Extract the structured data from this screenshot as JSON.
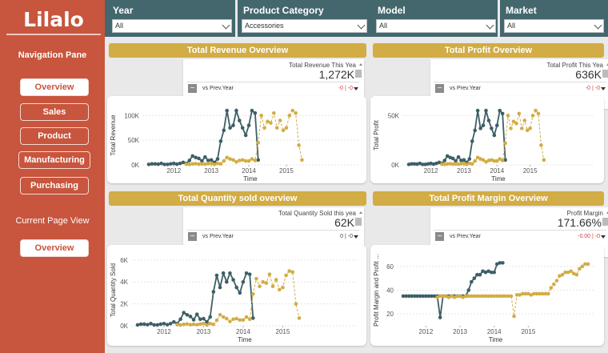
{
  "sidebar": {
    "logo": "Lilalo",
    "nav_title": "Navigation Pane",
    "nav_items": [
      "Overview",
      "Sales",
      "Product",
      "Manufacturing",
      "Purchasing"
    ],
    "current_title": "Current Page View",
    "current_page": "Overview"
  },
  "filters": [
    {
      "label": "Year",
      "value": "All"
    },
    {
      "label": "Product Category",
      "value": "Accessories"
    },
    {
      "label": "Model",
      "value": "All"
    },
    {
      "label": "Market",
      "value": "All"
    }
  ],
  "sections": {
    "revenue": "Total Revenue Overview",
    "profit": "Total Profit Overview",
    "quantity": "Total Quantity sold overview",
    "margin": "Total Profit Margin Overview"
  },
  "kpis": {
    "revenue": {
      "label": "Total Revenue This Yea",
      "value": "1,272K",
      "vs": "vs Prev.Year",
      "delta": "-0 | -0"
    },
    "profit": {
      "label": "Total Profit This Yea",
      "value": "636K",
      "vs": "vs Prev.Year",
      "delta": "-0 | -0"
    },
    "quantity": {
      "label": "Total Quantity Sold this yea",
      "value": "62K",
      "vs": "vs Prev.Year",
      "delta": "0 | -0"
    },
    "margin": {
      "label": "Profit Margin",
      "value": "171.66%",
      "vs": "vs Prev.Year",
      "delta": "-0.00 | -0"
    }
  },
  "colors": {
    "current_series": "#3d5f66",
    "previous_series": "#d2ac44",
    "sidebar": "#c8553d",
    "filterbar": "#44676e"
  },
  "chart_data": [
    {
      "type": "line",
      "id": "revenue",
      "ylabel": "Total Revenue",
      "xlabel": "Time",
      "x_ticks": [
        "2012",
        "2013",
        "2014",
        "2015"
      ],
      "y_ticks": [
        "0K",
        "50K",
        "100K"
      ],
      "ylim": [
        0,
        120000
      ],
      "series": [
        {
          "values": [
            1000,
            2000,
            2000,
            1500,
            3000,
            1000,
            1000,
            2000,
            3000,
            1500,
            3000,
            5000,
            3000,
            9000,
            18000,
            15000,
            13000,
            8000,
            16000,
            9000,
            10000,
            5000,
            12000,
            48000,
            70000,
            110000,
            75000,
            80000,
            110000,
            90000,
            75000,
            60000,
            80000,
            110000,
            105000,
            10000
          ]
        },
        {
          "values": [
            null,
            null,
            null,
            null,
            null,
            null,
            null,
            null,
            null,
            null,
            null,
            null,
            1500,
            1000,
            2000,
            2500,
            1500,
            2000,
            1500,
            2500,
            3000,
            1000,
            3000,
            2000,
            8000,
            15000,
            12000,
            10000,
            6000,
            9000,
            10000,
            8000,
            8000,
            12000,
            9000,
            45000,
            100000,
            75000,
            88000,
            85000,
            105000,
            75000,
            90000,
            70000,
            75000,
            100000,
            110000,
            105000,
            40000,
            10000
          ]
        }
      ]
    },
    {
      "type": "line",
      "id": "profit",
      "ylabel": "Total Profit",
      "xlabel": "Time",
      "x_ticks": [
        "2012",
        "2013",
        "2014",
        "2015"
      ],
      "y_ticks": [
        "0K",
        "50K"
      ],
      "ylim": [
        0,
        60000
      ],
      "series": [
        {
          "values": [
            500,
            1000,
            1000,
            800,
            1500,
            500,
            500,
            1000,
            1500,
            800,
            1500,
            2500,
            1500,
            4500,
            9000,
            7500,
            6500,
            4000,
            8000,
            4500,
            5000,
            2500,
            6000,
            24000,
            35000,
            55000,
            37000,
            40000,
            55000,
            45000,
            37000,
            30000,
            40000,
            55000,
            52000,
            5000
          ]
        },
        {
          "values": [
            null,
            null,
            null,
            null,
            null,
            null,
            null,
            null,
            null,
            null,
            null,
            null,
            700,
            500,
            1000,
            1200,
            700,
            1000,
            700,
            1200,
            1500,
            500,
            1500,
            1000,
            4000,
            7500,
            6000,
            5000,
            3000,
            4500,
            5000,
            4000,
            4000,
            6000,
            4500,
            22000,
            50000,
            37000,
            44000,
            42000,
            52000,
            37000,
            45000,
            35000,
            37000,
            50000,
            55000,
            52000,
            20000,
            5000
          ]
        }
      ]
    },
    {
      "type": "line",
      "id": "quantity",
      "ylabel": "Total Quantity Sold",
      "xlabel": "Time",
      "x_ticks": [
        "2012",
        "2013",
        "2014",
        "2015"
      ],
      "y_ticks": [
        "0K",
        "2K",
        "4K",
        "6K"
      ],
      "ylim": [
        0,
        6500
      ],
      "series": [
        {
          "values": [
            80,
            150,
            150,
            100,
            200,
            80,
            80,
            150,
            200,
            100,
            200,
            350,
            200,
            600,
            1200,
            1000,
            850,
            550,
            1050,
            600,
            650,
            350,
            800,
            3100,
            4600,
            3500,
            4800,
            4000,
            4800,
            4200,
            3500,
            3000,
            4000,
            4800,
            4700,
            700
          ]
        },
        {
          "values": [
            null,
            null,
            null,
            null,
            null,
            null,
            null,
            null,
            null,
            null,
            null,
            null,
            100,
            70,
            130,
            160,
            100,
            130,
            100,
            160,
            200,
            70,
            200,
            130,
            500,
            1000,
            800,
            650,
            400,
            600,
            650,
            530,
            530,
            800,
            600,
            2900,
            4300,
            3600,
            4000,
            3900,
            4700,
            3600,
            4200,
            3300,
            3500,
            4600,
            5000,
            4900,
            2000,
            700
          ]
        }
      ]
    },
    {
      "type": "line",
      "id": "margin",
      "ylabel": "Profit Margin and Profit ...",
      "xlabel": "Time",
      "x_ticks": [
        "2012",
        "2013",
        "2014",
        "2015"
      ],
      "y_ticks": [
        "20",
        "40",
        "60"
      ],
      "ylim": [
        10,
        70
      ],
      "series": [
        {
          "values": [
            35,
            35,
            35,
            35,
            35,
            35,
            35,
            35,
            35,
            35,
            35,
            35,
            35,
            17,
            35,
            35,
            35,
            35,
            35,
            35,
            35,
            35,
            35,
            40,
            47,
            50,
            53,
            53,
            56,
            55,
            56,
            55,
            55,
            62,
            63,
            63
          ]
        },
        {
          "values": [
            null,
            null,
            null,
            null,
            null,
            null,
            null,
            null,
            null,
            null,
            null,
            null,
            34,
            35,
            35,
            35,
            34,
            35,
            34,
            35,
            35,
            34,
            35,
            35,
            35,
            35,
            35,
            35,
            35,
            35,
            35,
            35,
            35,
            35,
            35,
            35,
            35,
            35,
            35,
            18,
            36,
            36,
            37,
            37,
            37,
            36,
            37,
            37,
            37,
            37,
            37,
            37,
            42,
            45,
            48,
            52,
            53,
            55,
            55,
            56,
            54,
            53,
            58,
            60,
            62,
            62
          ]
        }
      ]
    }
  ]
}
